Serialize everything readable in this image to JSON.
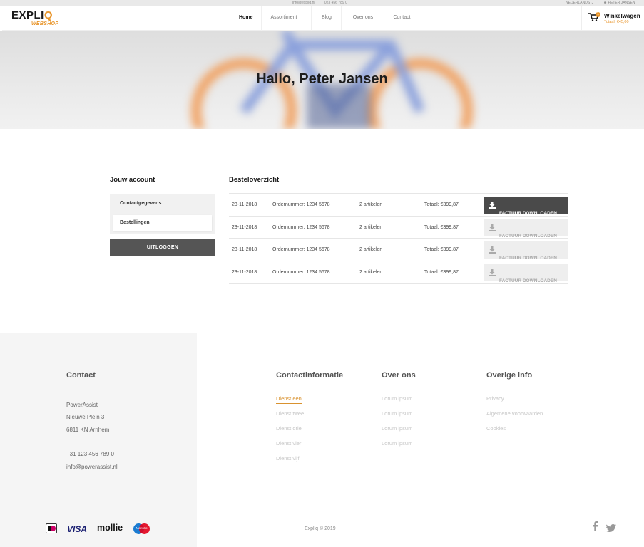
{
  "topbar": {
    "email": "info@expliq.nl",
    "phone": "023 456 789 0",
    "language": "NEDERLANDS",
    "user": "PETER JANSEN"
  },
  "logo": {
    "name_main": "EXPLI",
    "name_accent": "Q",
    "sub": "WEBSHOP"
  },
  "nav": [
    "Home",
    "Assortiment",
    "Blog",
    "Over ons",
    "Contact"
  ],
  "cart": {
    "label": "Winkelwagen",
    "total": "Totaal: €45,00",
    "count": "1"
  },
  "hero": {
    "greeting": "Hallo, Peter Jansen"
  },
  "account": {
    "title": "Jouw account",
    "items": [
      "Contactgegevens",
      "Bestellingen"
    ],
    "logout": "UITLOGGEN"
  },
  "orders": {
    "title": "Besteloverzicht",
    "rows": [
      {
        "date": "23-11-2018",
        "number": "Ordernummer: 1234 5678",
        "articles": "2 artikelen",
        "total": "Totaal: €399,87",
        "button": "FACTUUR DOWNLOADEN"
      },
      {
        "date": "23-11-2018",
        "number": "Ordernummer: 1234 5678",
        "articles": "2 artikelen",
        "total": "Totaal: €399,87",
        "button": "FACTUUR DOWNLOADEN"
      },
      {
        "date": "23-11-2018",
        "number": "Ordernummer: 1234 5678",
        "articles": "2 artikelen",
        "total": "Totaal: €399,87",
        "button": "FACTUUR DOWNLOADEN"
      },
      {
        "date": "23-11-2018",
        "number": "Ordernummer: 1234 5678",
        "articles": "2 artikelen",
        "total": "Totaal: €399,87",
        "button": "FACTUUR DOWNLOADEN"
      }
    ]
  },
  "footer": {
    "contact": {
      "title": "Contact",
      "company": "PowerAssist",
      "street": "Nieuwe Plein 3",
      "city": "6811 KN Arnhem",
      "phone": "+31 123 456 789 0",
      "email": "info@powerassist.nl"
    },
    "col1": {
      "title": "Contactinformatie",
      "links": [
        "Dienst een",
        "Dienst twee",
        "Dienst drie",
        "Dienst vier",
        "Dienst vijf"
      ]
    },
    "col2": {
      "title": "Over ons",
      "links": [
        "Lorum ipsum",
        "Lorum ipsum",
        "Lorum ipsum",
        "Lorum ipsum"
      ]
    },
    "col3": {
      "title": "Overige info",
      "links": [
        "Privacy",
        "Algemene voorwaarden",
        "Cookies"
      ]
    },
    "payments": {
      "ideal": "iD",
      "visa": "VISA",
      "mollie": "mollie",
      "maestro": "Maestro"
    },
    "copyright": "Expliq © 2019"
  },
  "colors": {
    "accent": "#e8952b",
    "dark_button": "#4a4a4a"
  }
}
